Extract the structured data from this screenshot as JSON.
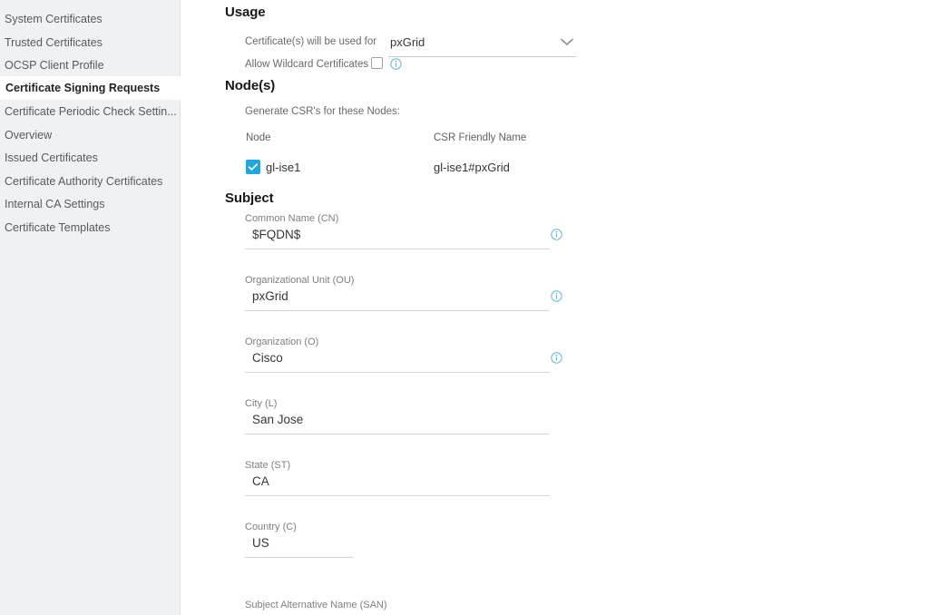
{
  "sidebar": {
    "items": [
      {
        "label": "System Certificates",
        "selected": false
      },
      {
        "label": "Trusted Certificates",
        "selected": false
      },
      {
        "label": "OCSP Client Profile",
        "selected": false
      },
      {
        "label": "Certificate Signing Requests",
        "selected": true
      },
      {
        "label": "Certificate Periodic Check Settin...",
        "selected": false
      },
      {
        "label": "Overview",
        "selected": false
      },
      {
        "label": "Issued Certificates",
        "selected": false
      },
      {
        "label": "Certificate Authority Certificates",
        "selected": false
      },
      {
        "label": "Internal CA Settings",
        "selected": false
      },
      {
        "label": "Certificate Templates",
        "selected": false
      }
    ]
  },
  "usage": {
    "heading": "Usage",
    "used_for_label": "Certificate(s) will be used for",
    "used_for_value": "pxGrid",
    "wildcard_label": "Allow Wildcard Certificates",
    "wildcard_checked": false
  },
  "nodes": {
    "heading": "Node(s)",
    "description": "Generate CSR's for these Nodes:",
    "columns": [
      "Node",
      "CSR Friendly Name"
    ],
    "rows": [
      {
        "checked": true,
        "node": "gl-ise1",
        "csr_friendly_name": "gl-ise1#pxGrid"
      }
    ]
  },
  "subject": {
    "heading": "Subject",
    "fields": [
      {
        "label": "Common Name (CN)",
        "value": "$FQDN$",
        "has_info": true
      },
      {
        "label": "Organizational Unit (OU)",
        "value": "pxGrid",
        "has_info": true
      },
      {
        "label": "Organization (O)",
        "value": "Cisco",
        "has_info": true
      },
      {
        "label": "City (L)",
        "value": "San Jose",
        "has_info": false
      },
      {
        "label": "State (ST)",
        "value": "CA",
        "has_info": false
      },
      {
        "label": "Country (C)",
        "value": "US",
        "has_info": false
      }
    ],
    "san_label": "Subject Alternative Name (SAN)"
  },
  "colors": {
    "accent": "#1fa8e0",
    "info": "#5bb8e3",
    "sidebar_bg": "#f0f1f3",
    "text": "#33373b"
  }
}
